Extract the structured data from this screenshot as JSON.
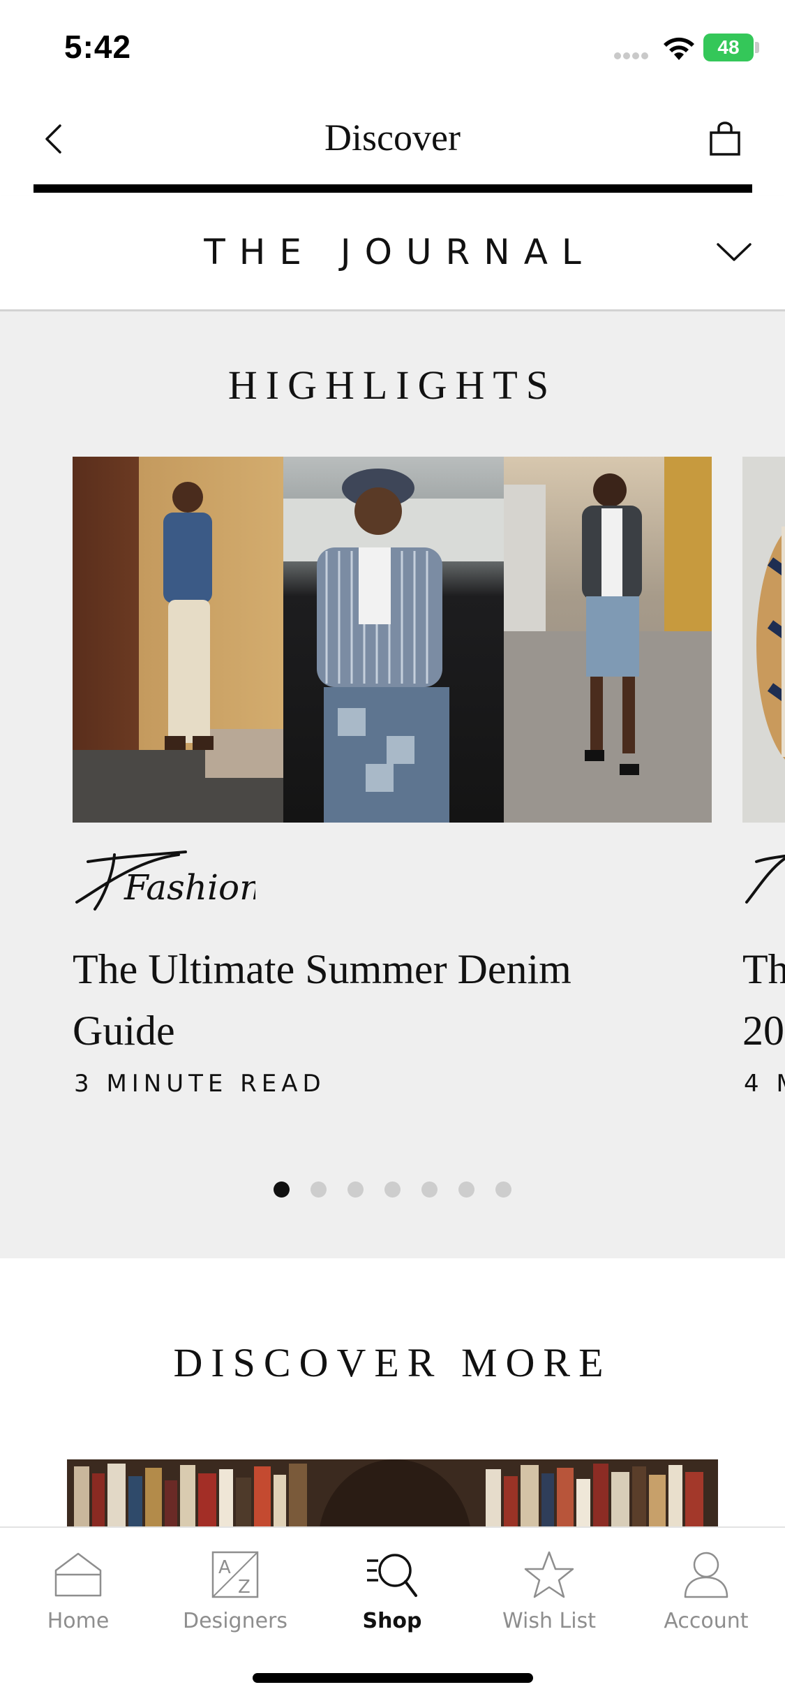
{
  "status_bar": {
    "time": "5:42",
    "battery": "48"
  },
  "nav": {
    "title": "Discover",
    "back_icon": "chevron-left-icon",
    "cart_icon": "shopping-bag-icon"
  },
  "journal": {
    "title": "THE JOURNAL",
    "toggle_icon": "chevron-down-icon"
  },
  "highlights": {
    "heading": "HIGHLIGHTS",
    "cards": [
      {
        "category": "Fashion",
        "title": "The Ultimate Summer Denim Guide",
        "read_time": "3 MINUTE READ"
      },
      {
        "category": "",
        "title": "Th",
        "title_line2": "20",
        "read_time": "4 M"
      }
    ],
    "pagination": {
      "count": 7,
      "active": 0
    }
  },
  "discover_more": {
    "heading": "DISCOVER MORE"
  },
  "tab_bar": {
    "items": [
      {
        "label": "Home",
        "icon": "home-icon",
        "active": false
      },
      {
        "label": "Designers",
        "icon": "a-z-icon",
        "active": false
      },
      {
        "label": "Shop",
        "icon": "search-icon",
        "active": true
      },
      {
        "label": "Wish List",
        "icon": "star-icon",
        "active": false
      },
      {
        "label": "Account",
        "icon": "person-icon",
        "active": false
      }
    ]
  },
  "colors": {
    "accent": "#111111",
    "inactive_tab": "#8e8e8e",
    "section_bg": "#efefef",
    "battery": "#34c759"
  }
}
